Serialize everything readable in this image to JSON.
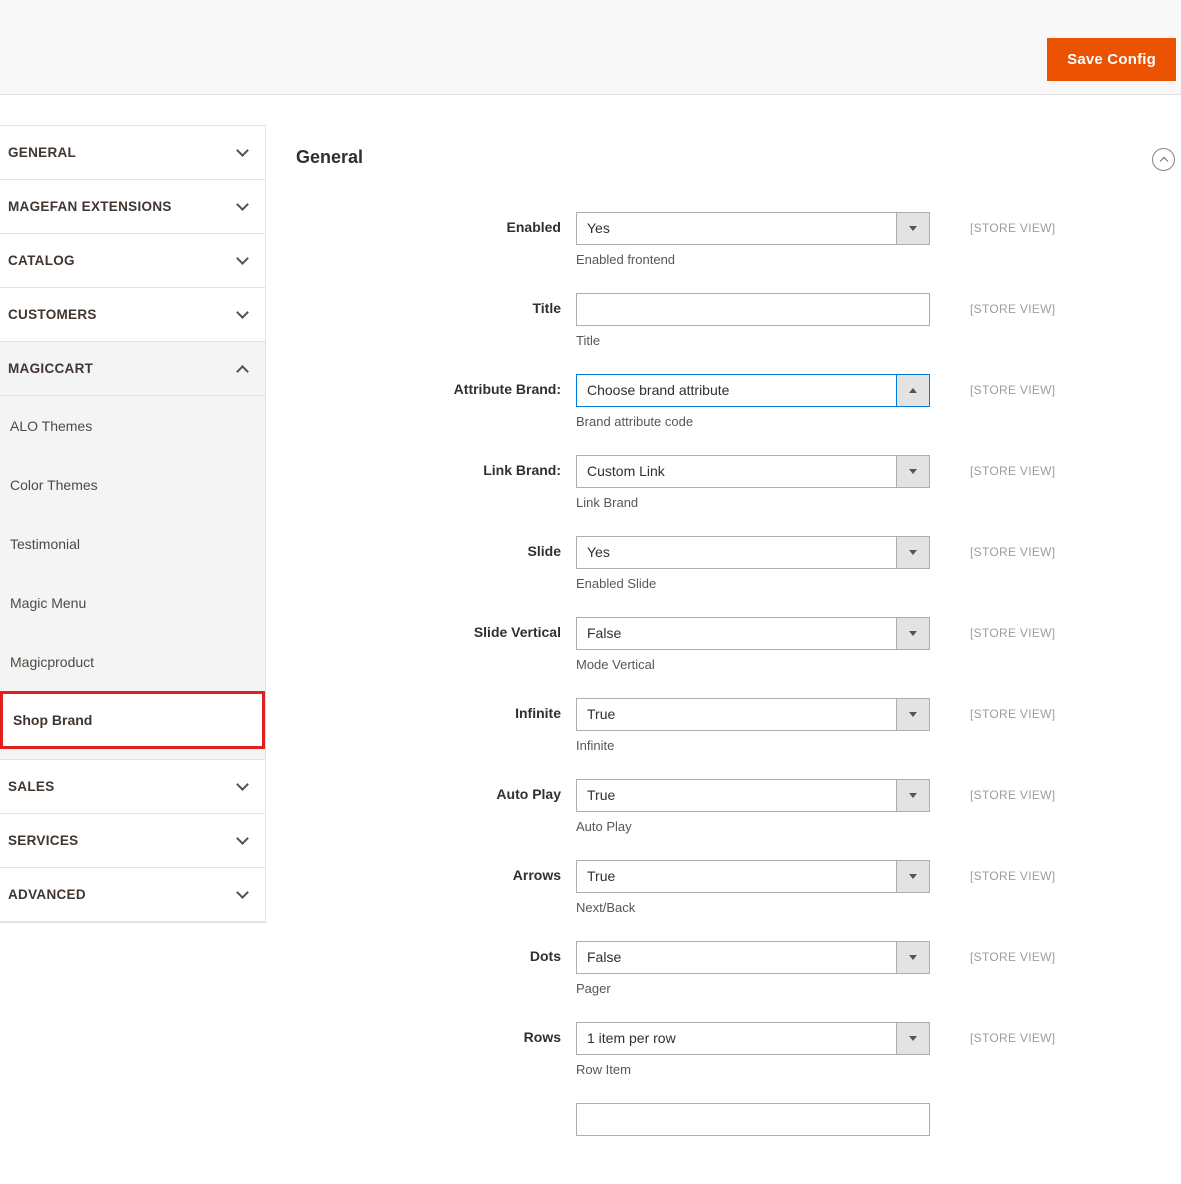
{
  "colors": {
    "accent": "#eb5202",
    "focus_border": "#007bdb",
    "highlight_box": "#e02020"
  },
  "header": {
    "save_button_label": "Save Config"
  },
  "panel": {
    "title": "General",
    "collapse_icon": "circle-chevron-up"
  },
  "sidebar": {
    "sections": [
      {
        "label": "GENERAL",
        "state": "collapsed",
        "icon": "chevron-down"
      },
      {
        "label": "MAGEFAN EXTENSIONS",
        "state": "collapsed",
        "icon": "chevron-down"
      },
      {
        "label": "CATALOG",
        "state": "collapsed",
        "icon": "chevron-down"
      },
      {
        "label": "CUSTOMERS",
        "state": "collapsed",
        "icon": "chevron-down"
      },
      {
        "label": "MAGICCART",
        "state": "expanded",
        "icon": "chevron-up",
        "children": [
          {
            "label": "ALO Themes",
            "selected": false
          },
          {
            "label": "Color Themes",
            "selected": false
          },
          {
            "label": "Testimonial",
            "selected": false
          },
          {
            "label": "Magic Menu",
            "selected": false
          },
          {
            "label": "Magicproduct",
            "selected": false
          },
          {
            "label": "Shop Brand",
            "selected": true
          }
        ]
      },
      {
        "label": "SALES",
        "state": "collapsed",
        "icon": "chevron-down"
      },
      {
        "label": "SERVICES",
        "state": "collapsed",
        "icon": "chevron-down"
      },
      {
        "label": "ADVANCED",
        "state": "collapsed",
        "icon": "chevron-down"
      }
    ]
  },
  "form": {
    "scope_label": "[STORE VIEW]",
    "fields": [
      {
        "label": "Enabled",
        "control": "select",
        "value": "Yes",
        "hint": "Enabled frontend",
        "scope": "[STORE VIEW]",
        "focused": false,
        "arrow_icon": "triangle-down"
      },
      {
        "label": "Title",
        "control": "input",
        "value": "",
        "placeholder": "",
        "hint": "Title",
        "scope": "[STORE VIEW]",
        "focused": false
      },
      {
        "label": "Attribute Brand:",
        "control": "select",
        "value": "Choose brand attribute",
        "hint": "Brand attribute code",
        "scope": "[STORE VIEW]",
        "focused": true,
        "arrow_icon": "triangle-up"
      },
      {
        "label": "Link Brand:",
        "control": "select",
        "value": "Custom Link",
        "hint": "Link Brand",
        "scope": "[STORE VIEW]",
        "focused": false,
        "arrow_icon": "triangle-down"
      },
      {
        "label": "Slide",
        "control": "select",
        "value": "Yes",
        "hint": "Enabled Slide",
        "scope": "[STORE VIEW]",
        "focused": false,
        "arrow_icon": "triangle-down"
      },
      {
        "label": "Slide Vertical",
        "control": "select",
        "value": "False",
        "hint": "Mode Vertical",
        "scope": "[STORE VIEW]",
        "focused": false,
        "arrow_icon": "triangle-down"
      },
      {
        "label": "Infinite",
        "control": "select",
        "value": "True",
        "hint": "Infinite",
        "scope": "[STORE VIEW]",
        "focused": false,
        "arrow_icon": "triangle-down"
      },
      {
        "label": "Auto Play",
        "control": "select",
        "value": "True",
        "hint": "Auto Play",
        "scope": "[STORE VIEW]",
        "focused": false,
        "arrow_icon": "triangle-down"
      },
      {
        "label": "Arrows",
        "control": "select",
        "value": "True",
        "hint": "Next/Back",
        "scope": "[STORE VIEW]",
        "focused": false,
        "arrow_icon": "triangle-down"
      },
      {
        "label": "Dots",
        "control": "select",
        "value": "False",
        "hint": "Pager",
        "scope": "[STORE VIEW]",
        "focused": false,
        "arrow_icon": "triangle-down"
      },
      {
        "label": "Rows",
        "control": "select",
        "value": "1 item per row",
        "hint": "Row Item",
        "scope": "[STORE VIEW]",
        "focused": false,
        "arrow_icon": "triangle-down"
      },
      {
        "label": "",
        "control": "input",
        "value": "",
        "placeholder": "",
        "hint": "",
        "scope": "",
        "focused": false
      }
    ]
  }
}
